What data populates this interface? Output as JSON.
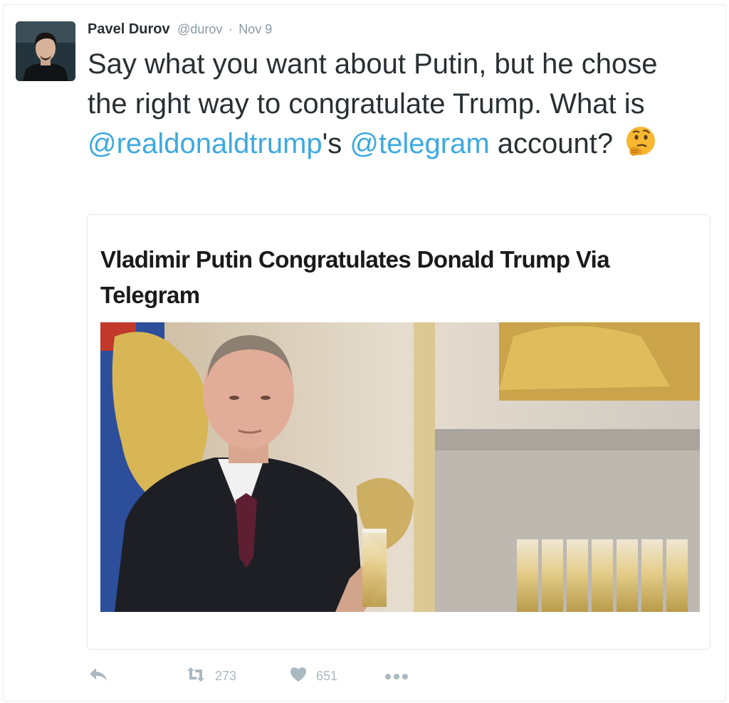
{
  "tweet": {
    "author": {
      "name": "Pavel Durov",
      "handle": "@durov",
      "separator": "·",
      "date": "Nov 9"
    },
    "text": {
      "part1": "Say what you want about Putin, but he chose the right way to congratulate Trump. What is ",
      "mention1": "@realdonaldtrump",
      "part2": "'s ",
      "mention2": "@telegram",
      "part3": " account?",
      "emoji": "thinking-face-emoji"
    },
    "card": {
      "title": "Vladimir Putin Congratulates Donald Trump Via Telegram",
      "image": "photo of man holding champagne glass"
    },
    "actions": {
      "reply_icon": "reply-icon",
      "retweet_icon": "retweet-icon",
      "retweet_count": "273",
      "like_icon": "heart-icon",
      "like_count": "651",
      "more_icon": "more-dots-icon"
    }
  },
  "colors": {
    "mention": "#3da9e0",
    "muted": "#8899a6",
    "action": "#aab8c2",
    "text": "#292f33"
  }
}
